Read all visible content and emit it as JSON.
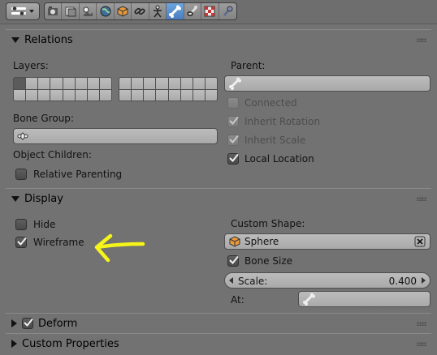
{
  "toolbar": {
    "editor_type_icon": "properties-editor-icon",
    "tabs": [
      {
        "icon": "render-icon"
      },
      {
        "icon": "render-layers-icon"
      },
      {
        "icon": "scene-icon"
      },
      {
        "icon": "world-icon"
      },
      {
        "icon": "object-icon"
      },
      {
        "icon": "constraints-icon"
      },
      {
        "icon": "object-data-armature-icon"
      },
      {
        "icon": "bone-icon",
        "active": true
      },
      {
        "icon": "bone-constraints-icon"
      },
      {
        "icon": "texture-icon"
      },
      {
        "icon": "wrench-icon"
      }
    ]
  },
  "relations": {
    "title": "Relations",
    "layers_label": "Layers:",
    "parent_label": "Parent:",
    "bone_group_label": "Bone Group:",
    "object_children_label": "Object Children:",
    "connected": {
      "label": "Connected",
      "checked": false,
      "disabled": true
    },
    "inherit_rotation": {
      "label": "Inherit Rotation",
      "checked": true,
      "disabled": true
    },
    "inherit_scale": {
      "label": "Inherit Scale",
      "checked": true,
      "disabled": true
    },
    "local_location": {
      "label": "Local Location",
      "checked": true,
      "disabled": false
    },
    "relative_parenting": {
      "label": "Relative Parenting",
      "checked": false
    }
  },
  "display": {
    "title": "Display",
    "hide": {
      "label": "Hide",
      "checked": false
    },
    "wireframe": {
      "label": "Wireframe",
      "checked": true
    },
    "custom_shape_label": "Custom Shape:",
    "custom_shape_value": "Sphere",
    "bone_size": {
      "label": "Bone Size",
      "checked": true
    },
    "scale_label": "Scale:",
    "scale_value": "0.400",
    "at_label": "At:"
  },
  "deform": {
    "title": "Deform",
    "checked": true
  },
  "custom_properties": {
    "title": "Custom Properties"
  },
  "annotation": {
    "color": "#f5f51a"
  }
}
